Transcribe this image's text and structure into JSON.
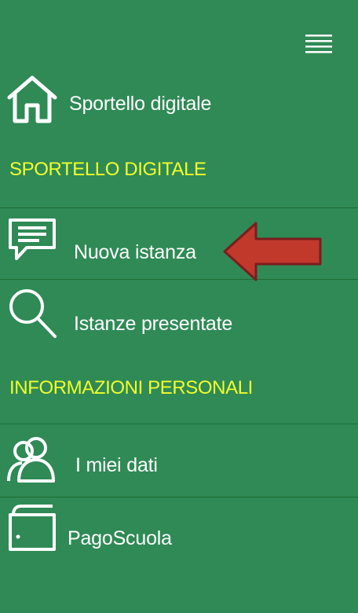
{
  "menu": {
    "toggle_icon": "hamburger-icon",
    "home": {
      "label": "Sportello digitale",
      "icon": "home-icon"
    },
    "sections": [
      {
        "heading": "SPORTELLO DIGITALE",
        "items": [
          {
            "label": "Nuova istanza",
            "icon": "message-icon"
          },
          {
            "label": "Istanze presentate",
            "icon": "search-icon"
          }
        ]
      },
      {
        "heading": "INFORMAZIONI PERSONALI",
        "items": [
          {
            "label": "I miei dati",
            "icon": "users-icon"
          },
          {
            "label": "PagoScuola",
            "icon": "wallet-icon"
          }
        ]
      }
    ]
  },
  "annotation": {
    "icon": "arrow-left-icon",
    "color": "#c0392b"
  },
  "colors": {
    "background": "#2f8a56",
    "heading": "#f2ff2a",
    "divider": "#1d6d32",
    "text": "#ffffff"
  }
}
